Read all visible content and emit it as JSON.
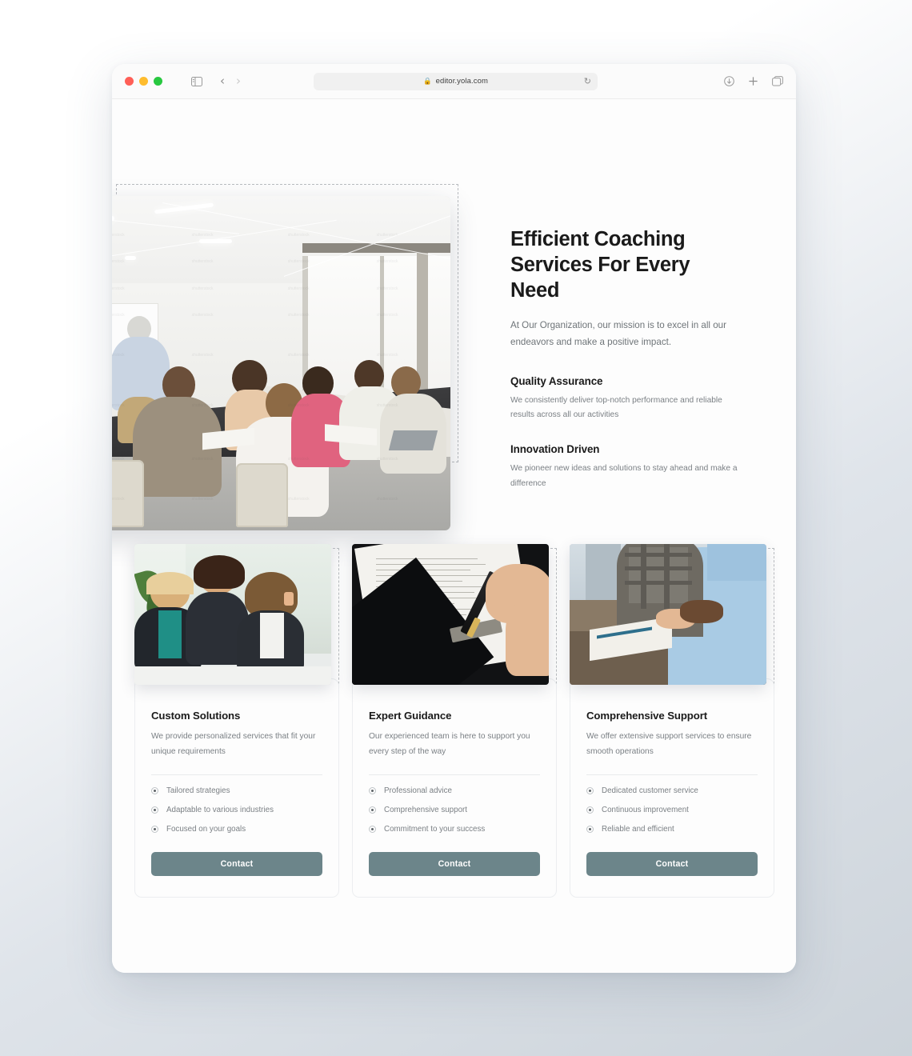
{
  "browser": {
    "url": "editor.yola.com",
    "lock_icon": "lock-icon",
    "reload_icon": "reload-icon",
    "sidebar_icon": "sidebar-toggle-icon",
    "back_icon": "chevron-left-icon",
    "forward_icon": "chevron-right-icon",
    "shield_icon": "privacy-shield-icon",
    "download_icon": "download-icon",
    "new_tab_icon": "plus-icon",
    "tab_overview_icon": "tab-overview-icon",
    "traffic": {
      "close": "close-window-button",
      "minimize": "minimize-window-button",
      "zoom": "zoom-window-button"
    }
  },
  "hero": {
    "title_line1": "Efficient Coaching",
    "title_line2": "Services For Every Need",
    "subtitle": "At Our Organization, our mission is to excel in all our endeavors and make a positive impact.",
    "image_alt": "team-meeting-photo",
    "features": [
      {
        "title": "Quality Assurance",
        "body": "We consistently deliver top-notch performance and reliable results across all our activities"
      },
      {
        "title": "Innovation Driven",
        "body": "We pioneer new ideas and solutions to stay ahead and make a difference"
      }
    ]
  },
  "cards": [
    {
      "title": "Custom Solutions",
      "desc": "We provide personalized services that fit your unique requirements",
      "image_alt": "business-women-meeting-photo",
      "bullets": [
        "Tailored strategies",
        "Adaptable to various industries",
        "Focused on your goals"
      ],
      "button": "Contact"
    },
    {
      "title": "Expert Guidance",
      "desc": "Our experienced team is here to support you every step of the way",
      "image_alt": "signing-document-photo",
      "bullets": [
        "Professional advice",
        "Comprehensive support",
        "Commitment to your success"
      ],
      "button": "Contact"
    },
    {
      "title": "Comprehensive Support",
      "desc": "We offer extensive support services to ensure smooth operations",
      "image_alt": "handshake-agreement-photo",
      "bullets": [
        "Dedicated customer service",
        "Continuous improvement",
        "Reliable and efficient"
      ],
      "button": "Contact"
    }
  ],
  "colors": {
    "accent_button": "#6c858a",
    "heading": "#1a1a1a",
    "body_text": "#7b8085",
    "dashed_outline": "#b9bcc0",
    "page_background": "#fdfdfd"
  }
}
